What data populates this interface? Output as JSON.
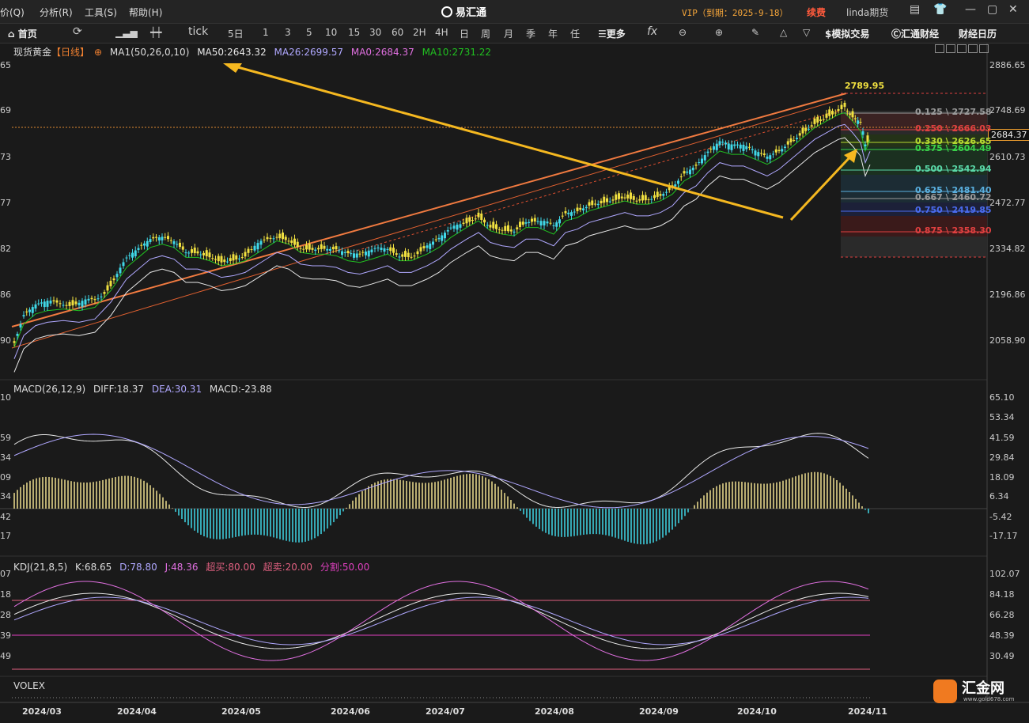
{
  "menu": [
    "报价(Q)",
    "分析(R)",
    "工具(S)",
    "帮助(H)"
  ],
  "app_title": "易汇通",
  "vip": "VIP（到期：2025-9-18）",
  "renew": "续费",
  "user": "linda期货",
  "toolbar": {
    "home": "首页",
    "periods": [
      "tick",
      "5日",
      "1",
      "3",
      "5",
      "10",
      "15",
      "30",
      "60",
      "2H",
      "4H",
      "日",
      "周",
      "月",
      "季",
      "年",
      "任"
    ],
    "more": "更多",
    "sim_trade": "模拟交易",
    "news": "汇通财经",
    "calendar": "财经日历"
  },
  "main_legend": {
    "symbol": "现货黄金",
    "period": "【日线】",
    "ma1": "MA1(50,26,0,10)",
    "ma50": "MA50:2643.32",
    "ma26": "MA26:2699.57",
    "ma0": "MA0:2684.37",
    "ma10": "MA10:2731.22"
  },
  "price_axis": [
    "2886.65",
    "2748.69",
    "2610.73",
    "2472.77",
    "2334.82",
    "2196.86",
    "2058.90"
  ],
  "price_axis_left": [
    "65",
    "69",
    "73",
    "77",
    "82",
    "86",
    "90"
  ],
  "last_price": "2684.37",
  "high_label": "2789.95",
  "fib_levels": [
    {
      "label": "0.125 \\ 2727.58",
      "color": "#9a9a9a"
    },
    {
      "label": "0.250 \\ 2666.03",
      "color": "#e04040"
    },
    {
      "label": "0.330 \\ 2626.65",
      "color": "#b5d830"
    },
    {
      "label": "0.375 \\ 2604.49",
      "color": "#3ad04a"
    },
    {
      "label": "0.500 \\ 2542.94",
      "color": "#5ad9a8"
    },
    {
      "label": "0.625 \\ 2481.40",
      "color": "#5ab0e0"
    },
    {
      "label": "0.667 \\ 2460.72",
      "color": "#9a9a9a"
    },
    {
      "label": "0.750 \\ 2419.85",
      "color": "#4a6cf0"
    },
    {
      "label": "0.875 \\ 2358.30",
      "color": "#e04040"
    }
  ],
  "macd": {
    "legend": "MACD(26,12,9)",
    "diff": "DIFF:18.37",
    "dea": "DEA:30.31",
    "macd": "MACD:-23.88",
    "axis": [
      "65.10",
      "53.34",
      "41.59",
      "29.84",
      "18.09",
      "6.34",
      "-5.42",
      "-17.17"
    ],
    "axis_left": [
      "10",
      "59",
      "34",
      "09",
      "34",
      "42",
      "17"
    ]
  },
  "kdj": {
    "legend": "KDJ(21,8,5)",
    "k": "K:68.65",
    "d": "D:78.80",
    "j": "J:48.36",
    "overbought": "超买:80.00",
    "oversold": "超卖:20.00",
    "split": "分割:50.00",
    "axis": [
      "102.07",
      "84.18",
      "66.28",
      "48.39",
      "30.49"
    ],
    "axis_left": [
      "07",
      "18",
      "28",
      "39",
      "49"
    ]
  },
  "volex": "VOLEX",
  "dates": [
    "2024/03",
    "2024/04",
    "2024/05",
    "2024/06",
    "2024/07",
    "2024/08",
    "2024/09",
    "2024/10",
    "2024/11"
  ],
  "brand": {
    "name": "汇金网",
    "url": "www.gold678.com"
  },
  "colors": {
    "up": "#f0e040",
    "down": "#40d8e8",
    "ma_green": "#20c020",
    "ma_white": "#e8e8e8",
    "ma_lavender": "#b0a8ff",
    "trend": "#f07a40",
    "arrow": "#f5b820"
  }
}
